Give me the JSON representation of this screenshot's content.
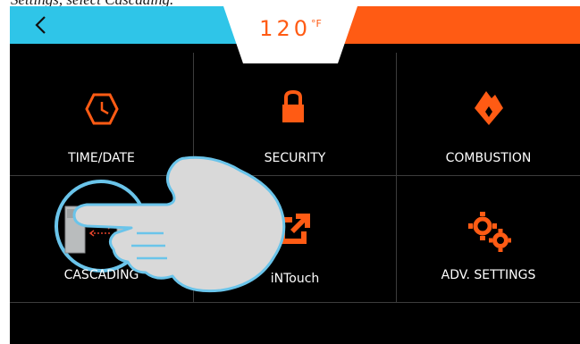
{
  "caption": "Settings, select Cascading.",
  "header": {
    "temperature": "120",
    "unit": "°F"
  },
  "tiles": [
    {
      "label": "TIME/DATE",
      "icon": "clock-icon"
    },
    {
      "label": "SECURITY",
      "icon": "lock-icon"
    },
    {
      "label": "COMBUSTION",
      "icon": "flame-icon"
    },
    {
      "label": "CASCADING",
      "icon": "cascade-boilers-icon"
    },
    {
      "label": "iNTouch",
      "icon": "external-link-icon"
    },
    {
      "label": "ADV. SETTINGS",
      "icon": "gears-icon"
    }
  ],
  "colors": {
    "accent_blue": "#2fc5e8",
    "accent_orange": "#ff5b14",
    "background": "#000000"
  }
}
